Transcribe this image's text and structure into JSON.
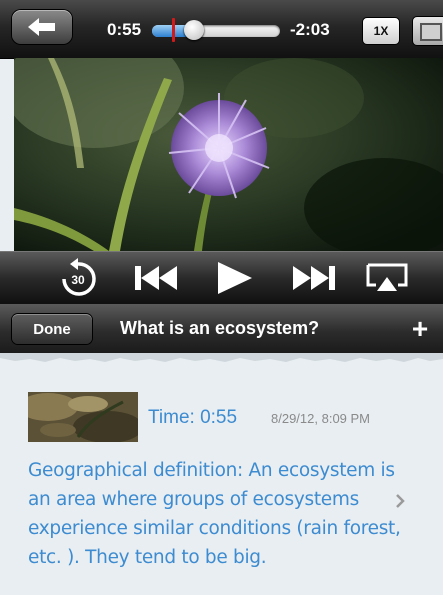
{
  "player": {
    "time_elapsed": "0:55",
    "time_remaining": "-2:03",
    "progress_fraction": 0.31,
    "speed_label": "1X",
    "skip_back_seconds": "30"
  },
  "header": {
    "done_label": "Done",
    "title": "What is an ecosystem?",
    "add_label": "+"
  },
  "note": {
    "time_label": "Time: 0:55",
    "date": "8/29/12, 8:09 PM",
    "text": "Geographical definition: An ecosystem is an area where groups of ecosystems experience similar conditions (rain forest, etc. ). They tend to be big."
  },
  "icons": {
    "back": "back-arrow-icon",
    "fullscreen": "fullscreen-icon",
    "skip_back": "skip-back-30-icon",
    "previous": "previous-track-icon",
    "play": "play-icon",
    "next": "next-track-icon",
    "airplay": "airplay-icon",
    "chevron": "chevron-right-icon"
  },
  "colors": {
    "note_text": "#3d8bd0",
    "progress_fill": "#2d7fd0",
    "marker": "#d31a1a"
  }
}
